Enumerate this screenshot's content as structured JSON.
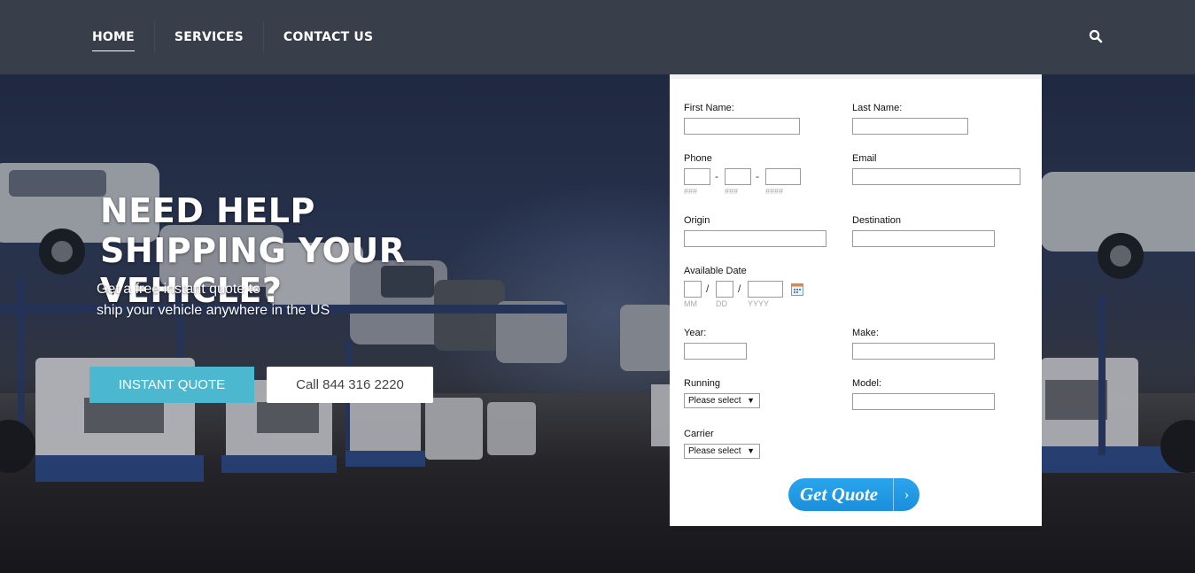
{
  "nav": {
    "items": [
      {
        "label": "HOME",
        "active": true
      },
      {
        "label": "SERVICES",
        "active": false
      },
      {
        "label": "CONTACT US",
        "active": false
      }
    ],
    "search_icon": "search-icon"
  },
  "hero": {
    "title": "NEED HELP SHIPPING YOUR VEHICLE?",
    "subtitle_line1": "Get a free instant quote to",
    "subtitle_line2": "ship your vehicle anywhere in the US",
    "instant_quote_label": "INSTANT QUOTE",
    "call_label": "Call 844 316 2220"
  },
  "form": {
    "first_name_label": "First Name:",
    "last_name_label": "Last Name:",
    "phone_label": "Phone",
    "email_label": "Email",
    "phone_hint_1": "###",
    "phone_hint_2": "###",
    "phone_hint_3": "####",
    "phone_sep": "-",
    "origin_label": "Origin",
    "destination_label": "Destination",
    "available_date_label": "Available Date",
    "date_sep": "/",
    "date_hint_mm": "MM",
    "date_hint_dd": "DD",
    "date_hint_yyyy": "YYYY",
    "year_label": "Year:",
    "make_label": "Make:",
    "running_label": "Running",
    "model_label": "Model:",
    "carrier_label": "Carrier",
    "running_select": "Please select",
    "carrier_select": "Please select",
    "select_arrow": "▼",
    "submit_label": "Get Quote",
    "submit_arrow": "›"
  },
  "colors": {
    "nav_bg": "#383f4a",
    "instant_quote_bg": "#4cb8cf",
    "get_quote_bg": "#1a8fdc"
  }
}
